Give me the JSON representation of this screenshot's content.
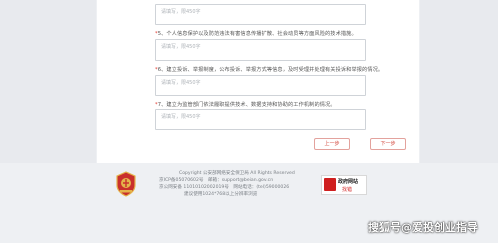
{
  "form": {
    "placeholder": "请填写，限450字",
    "questions": [
      {
        "num": "5",
        "text": "、个人信息保护以及防范违法有害信息传播扩散、社会动员等方面风险的技术措施。"
      },
      {
        "num": "6",
        "text": "、建立投诉、举报制度，公布投诉、举报方式等信息，及时受理并处理有关投诉和举报的情况。"
      },
      {
        "num": "7",
        "text": "、建立为监管部门依法履职提供技术、数据支持和协助的工作机制的情况。"
      }
    ],
    "prev_button": "上一步",
    "next_button": "下一步"
  },
  "footer": {
    "copyright": "Copyright 公安部网络安全保卫局 All Rights Reserved",
    "icp": "京ICP备05070602号",
    "email_label": "邮箱：",
    "email": "support@beian.gov.cn",
    "gongan": "京公网安备 11010102002019号",
    "phone_label": "网站电话：",
    "phone": "(tel)59000026",
    "tip": "建议使用1024*768以上分辨率浏览",
    "gov_badge_title": "政府网站",
    "gov_badge_sub": "找错"
  },
  "watermark": "搜狐号@爱投创业指导",
  "colors": {
    "accent": "#d2453a",
    "gov_red": "#cf1f1f"
  }
}
